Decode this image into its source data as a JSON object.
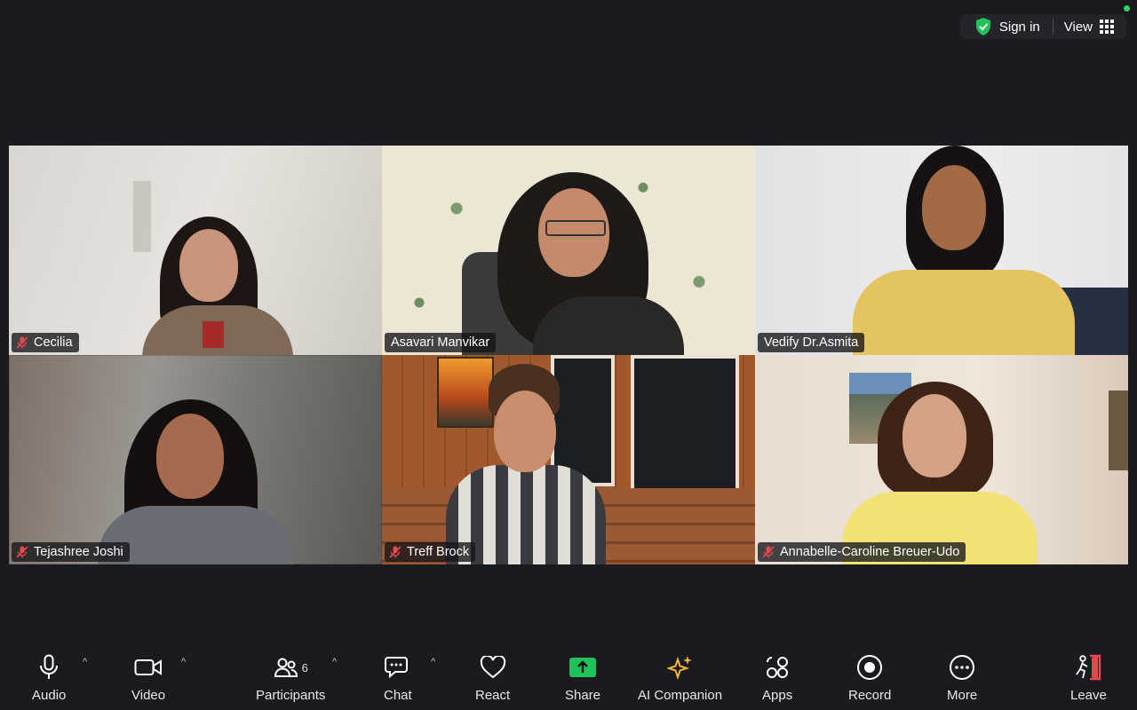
{
  "topbar": {
    "sign_in": "Sign in",
    "view": "View"
  },
  "participants": [
    {
      "name": "Cecilia",
      "muted": true
    },
    {
      "name": "Asavari Manvikar",
      "muted": false,
      "active": true
    },
    {
      "name": "Vedify Dr.Asmita",
      "muted": false
    },
    {
      "name": "Tejashree Joshi",
      "muted": true
    },
    {
      "name": "Treff Brock",
      "muted": true
    },
    {
      "name": "Annabelle-Caroline Breuer-Udo",
      "muted": true
    }
  ],
  "toolbar": {
    "audio": "Audio",
    "video": "Video",
    "participants": "Participants",
    "participants_count": "6",
    "chat": "Chat",
    "react": "React",
    "share": "Share",
    "ai_companion": "AI Companion",
    "apps": "Apps",
    "record": "Record",
    "more": "More",
    "leave": "Leave"
  },
  "colors": {
    "background": "#1a1b1f",
    "active_speaker": "#2fbe52",
    "share": "#1fc35a",
    "leave": "#e5484d",
    "mute": "#e5484d"
  }
}
